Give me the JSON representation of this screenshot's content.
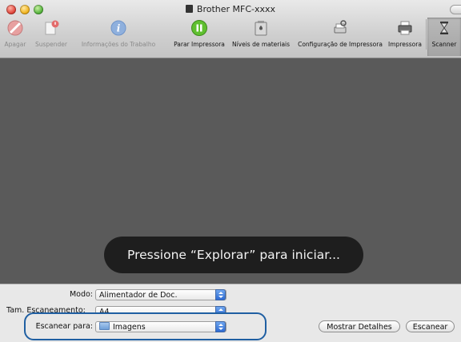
{
  "window": {
    "title": "Brother MFC-xxxx"
  },
  "toolbar": {
    "items": [
      {
        "label": "Apagar",
        "icon": "delete-icon",
        "enabled": false
      },
      {
        "label": "Suspender",
        "icon": "suspend-icon",
        "enabled": false
      },
      {
        "label": "Informações do Trabalho",
        "icon": "info-icon",
        "enabled": false
      },
      {
        "label": "Parar Impressora",
        "icon": "pause-icon",
        "enabled": true
      },
      {
        "label": "Níveis de materiais",
        "icon": "supply-levels-icon",
        "enabled": true
      },
      {
        "label": "Configuração de Impressora",
        "icon": "printer-setup-icon",
        "enabled": true
      },
      {
        "label": "Impressora",
        "icon": "printer-icon",
        "enabled": true
      },
      {
        "label": "Scanner",
        "icon": "scanner-icon",
        "enabled": true
      }
    ]
  },
  "preview": {
    "message": "Pressione “Explorar” para iniciar..."
  },
  "form": {
    "mode_label": "Modo:",
    "mode_value": "Alimentador de Doc.",
    "scan_size_label": "Tam. Escaneamento:",
    "scan_size_value": "A4",
    "scan_to_label": "Escanear para:",
    "scan_to_value": "Imagens",
    "show_details_button": "Mostrar Detalhes",
    "scan_button": "Escanear"
  },
  "colors": {
    "preview_background": "#5a5a5a",
    "hud_background": "#161616",
    "callout_outline": "#1f5fa2",
    "accent_stepper": "#2e6bd2"
  }
}
